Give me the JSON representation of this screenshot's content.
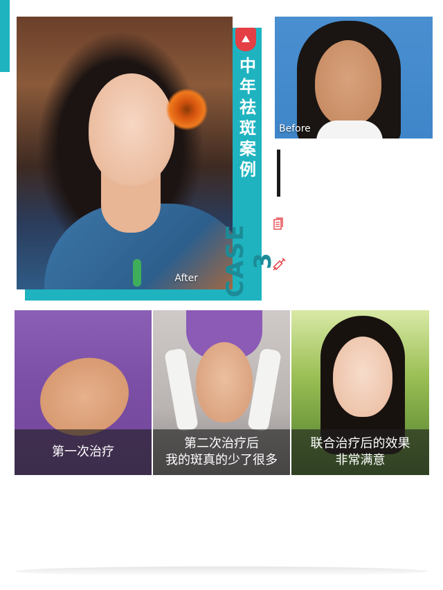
{
  "title": {
    "vertical_text": "中年祛斑案例",
    "case_number": "CASE 3"
  },
  "photos": {
    "after_label": "After",
    "before_label": "Before"
  },
  "icons": {
    "badge": "crown-badge-icon",
    "document": "document-icon",
    "syringe": "syringe-icon"
  },
  "treatments": [
    {
      "lines": [
        "第一次治疗"
      ]
    },
    {
      "lines": [
        "第二次治疗后",
        "我的斑真的少了很多"
      ]
    },
    {
      "lines": [
        "联合治疗后的效果",
        "非常满意"
      ]
    }
  ],
  "colors": {
    "accent": "#1fb3c0",
    "accent_dark": "#1b8c97",
    "badge_red": "#e33f44"
  }
}
